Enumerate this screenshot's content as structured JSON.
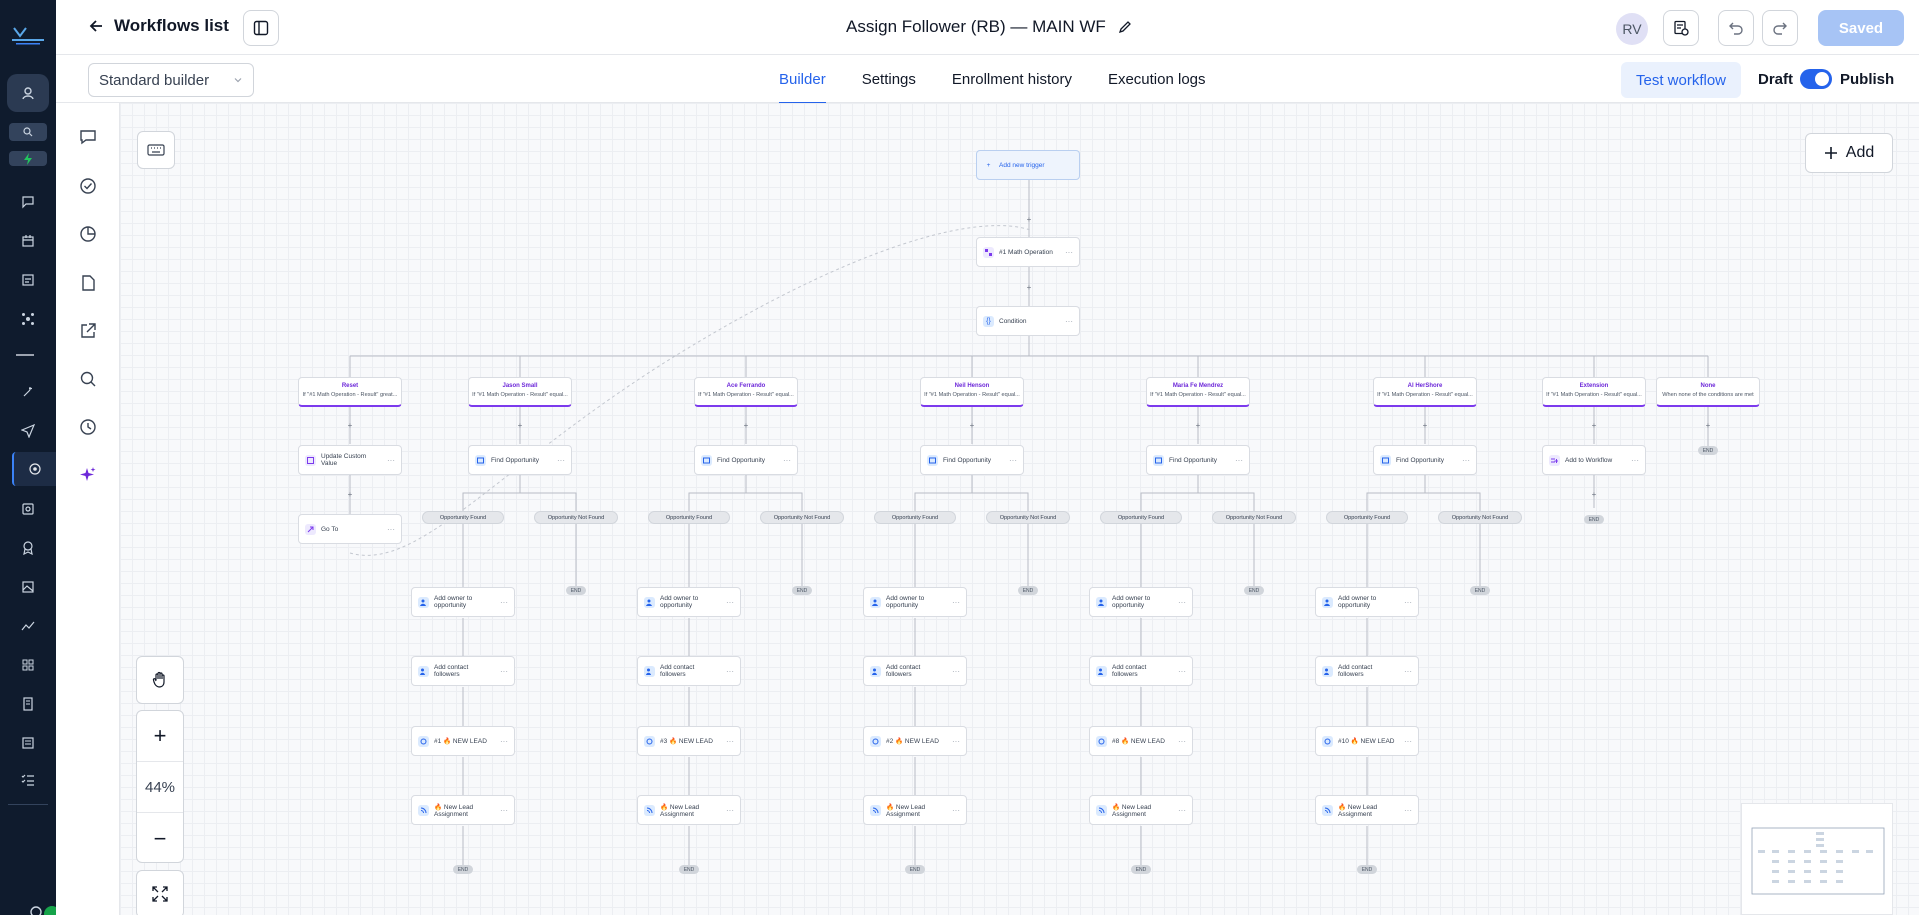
{
  "header": {
    "back_label": "Workflows list",
    "title": "Assign Follower (RB) — MAIN WF",
    "avatar_initials": "RV",
    "saved_label": "Saved"
  },
  "subheader": {
    "builder_mode": "Standard builder",
    "tabs": [
      {
        "label": "Builder",
        "active": true
      },
      {
        "label": "Settings",
        "active": false
      },
      {
        "label": "Enrollment history",
        "active": false
      },
      {
        "label": "Execution logs",
        "active": false
      }
    ],
    "test_label": "Test workflow",
    "draft_label": "Draft",
    "publish_label": "Publish"
  },
  "canvas": {
    "add_label": "Add",
    "zoom_level": "44%",
    "trigger_label": "Add new trigger",
    "math_label": "#1 Math Operation",
    "condition_label": "Condition",
    "branches": [
      {
        "title": "Reset",
        "subtitle": "If \"#1 Math Operation - Result\" great..."
      },
      {
        "title": "Jason Small",
        "subtitle": "If \"#1 Math Operation - Result\" equal..."
      },
      {
        "title": "Ace Ferrando",
        "subtitle": "If \"#1 Math Operation - Result\" equal..."
      },
      {
        "title": "Neil Henson",
        "subtitle": "If \"#1 Math Operation - Result\" equal..."
      },
      {
        "title": "Maria Fe Mendrez",
        "subtitle": "If \"#1 Math Operation - Result\" equal..."
      },
      {
        "title": "Al HerShore",
        "subtitle": "If \"#1 Math Operation - Result\" equal..."
      },
      {
        "title": "Extension",
        "subtitle": "If \"#1 Math Operation - Result\" equal..."
      },
      {
        "title": "None",
        "subtitle": "When none of the conditions are met"
      }
    ],
    "reset_actions": [
      "Update Custom Value",
      "Go To"
    ],
    "find_label": "Find Opportunity",
    "found_label": "Opportunity Found",
    "not_found_label": "Opportunity Not Found",
    "add_owner_label": "Add owner to opportunity",
    "add_followers_label": "Add contact followers",
    "new_lead_labels": [
      "#1 🔥 NEW LEAD",
      "#3 🔥 NEW LEAD",
      "#2 🔥 NEW LEAD",
      "#8 🔥 NEW LEAD",
      "#10 🔥 NEW LEAD"
    ],
    "assignment_label": "🔥 New Lead Assignment",
    "extension_action": "Add to Workflow",
    "end_label": "END"
  },
  "colors": {
    "accent": "#2563eb",
    "branch": "#7c3aed",
    "nav_bg": "#0f1b2d",
    "saved_bg": "#a7c4f5"
  }
}
